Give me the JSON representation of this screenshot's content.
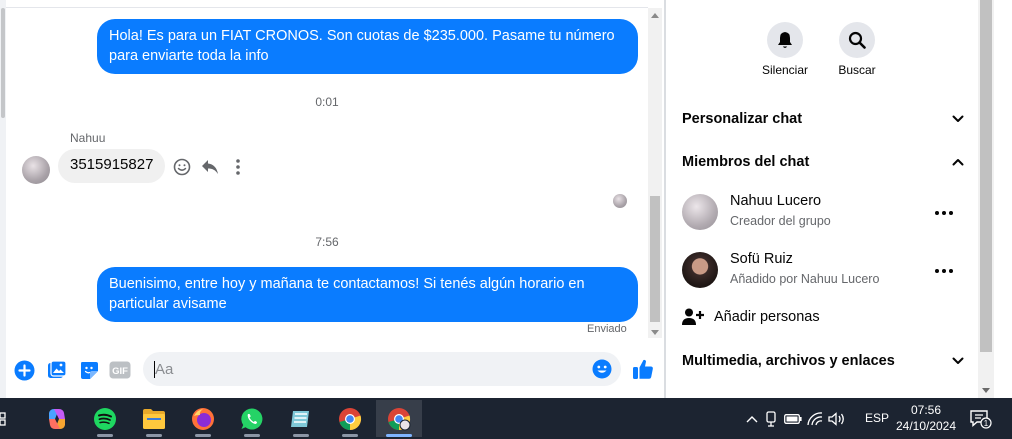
{
  "chat": {
    "messages": {
      "msg1": {
        "text": "Hola! Es para un FIAT CRONOS. Son cuotas de $235.000. Pasame tu número para enviarte toda la info"
      },
      "ts1": "0:01",
      "incoming": {
        "sender": "Nahuu",
        "text": "3515915827"
      },
      "ts2": "7:56",
      "msg2": {
        "text": "Buenisimo, entre hoy y mañana te contactamos! Si tenés algún horario en particular avisame",
        "status": "Enviado"
      }
    },
    "composer": {
      "placeholder": "Aa",
      "gif_label": "GIF"
    }
  },
  "info": {
    "actions": {
      "mute_label": "Silenciar",
      "search_label": "Buscar"
    },
    "sections": {
      "customize": "Personalizar chat",
      "members": "Miembros del chat",
      "media": "Multimedia, archivos y enlaces"
    },
    "members": [
      {
        "name": "Nahuu Lucero",
        "role": "Creador del grupo"
      },
      {
        "name": "Sofü Ruiz",
        "role": "Añadido por Nahuu Lucero"
      }
    ],
    "add_people_label": "Añadir personas"
  },
  "colors": {
    "accent": "#0a7cff",
    "bubble_in": "#f0f0f0",
    "taskbar": "#1c2431"
  },
  "taskbar": {
    "apps": [
      "widgets-icon",
      "copilot-icon",
      "spotify-icon",
      "file-explorer-icon",
      "firefox-icon",
      "whatsapp-icon",
      "notes-icon",
      "chrome-icon",
      "chrome-profile-icon"
    ],
    "language": "ESP",
    "time": "07:56",
    "date": "24/10/2024",
    "notification_count": "1"
  }
}
